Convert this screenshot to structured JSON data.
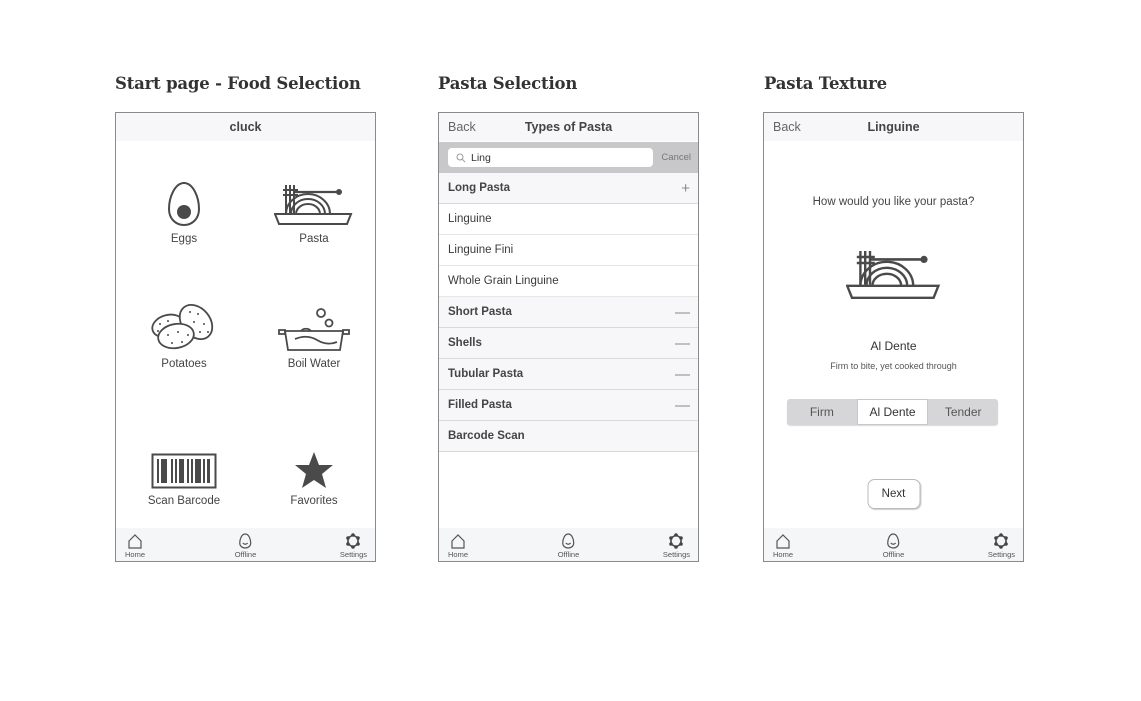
{
  "screens": [
    {
      "section_title": "Start page - Food Selection",
      "nav_title": "cluck",
      "grid": [
        {
          "label": "Eggs",
          "icon": "egg-icon"
        },
        {
          "label": "Pasta",
          "icon": "pasta-icon"
        },
        {
          "label": "Potatoes",
          "icon": "potatoes-icon"
        },
        {
          "label": "Boil Water",
          "icon": "pot-icon"
        },
        {
          "label": "Scan Barcode",
          "icon": "barcode-icon"
        },
        {
          "label": "Favorites",
          "icon": "star-icon"
        }
      ]
    },
    {
      "section_title": "Pasta Selection",
      "nav_back": "Back",
      "nav_title": "Types of Pasta",
      "search": {
        "value": "Ling",
        "cancel": "Cancel"
      },
      "list": [
        {
          "type": "section",
          "label": "Long Pasta",
          "ctrl": "+"
        },
        {
          "type": "item",
          "label": "Linguine"
        },
        {
          "type": "item",
          "label": "Linguine Fini"
        },
        {
          "type": "item",
          "label": "Whole Grain Linguine"
        },
        {
          "type": "section",
          "label": "Short Pasta",
          "ctrl": "—"
        },
        {
          "type": "section",
          "label": "Shells",
          "ctrl": "—"
        },
        {
          "type": "section",
          "label": "Tubular Pasta",
          "ctrl": "—"
        },
        {
          "type": "section",
          "label": "Filled Pasta",
          "ctrl": "—"
        },
        {
          "type": "section",
          "label": "Barcode Scan",
          "ctrl": ""
        }
      ]
    },
    {
      "section_title": "Pasta Texture",
      "nav_back": "Back",
      "nav_title": "Linguine",
      "question": "How would you like your pasta?",
      "texture_name": "Al Dente",
      "texture_desc": "Firm to bite, yet cooked through",
      "segments": [
        "Firm",
        "Al Dente",
        "Tender"
      ],
      "selected_segment": "Al Dente",
      "next_label": "Next"
    }
  ],
  "tabbar": {
    "home": "Home",
    "offline": "Offline",
    "settings": "Settings"
  }
}
